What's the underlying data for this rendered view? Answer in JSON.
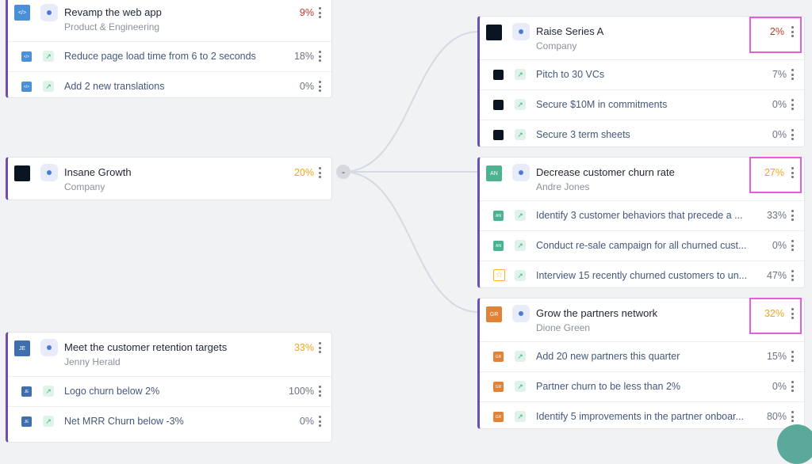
{
  "cards": {
    "web": {
      "title": "Revamp the web app",
      "owner": "Product & Engineering",
      "progress": "9%",
      "icon": "code-window-icon",
      "rows": [
        {
          "label": "Reduce page load time from 6 to 2 seconds",
          "progress": "18%"
        },
        {
          "label": "Add 2 new translations",
          "progress": "0%"
        }
      ]
    },
    "growth": {
      "title": "Insane Growth",
      "owner": "Company",
      "progress": "20%",
      "collapse_label": "-"
    },
    "retention": {
      "title": "Meet the customer retention targets",
      "owner": "Jenny Herald",
      "progress": "33%",
      "initials": "JE",
      "rows": [
        {
          "label": "Logo churn below 2%",
          "progress": "100%",
          "initials": "JE"
        },
        {
          "label": "Net MRR Churn below -3%",
          "progress": "0%",
          "initials": "JE"
        }
      ]
    },
    "series_a": {
      "title": "Raise Series A",
      "owner": "Company",
      "progress": "2%",
      "rows": [
        {
          "label": "Pitch to 30 VCs",
          "progress": "7%"
        },
        {
          "label": "Secure $10M in commitments",
          "progress": "0%"
        },
        {
          "label": "Secure 3 term sheets",
          "progress": "0%"
        }
      ]
    },
    "churn": {
      "title": "Decrease customer churn rate",
      "owner": "Andre Jones",
      "progress": "27%",
      "initials": "AN",
      "rows": [
        {
          "label": "Identify 3 customer behaviors that precede a ...",
          "progress": "33%",
          "initials": "AN"
        },
        {
          "label": "Conduct re-sale campaign for all churned cust...",
          "progress": "0%",
          "initials": "AN"
        },
        {
          "label": "Interview 15 recently churned customers to un...",
          "progress": "47%",
          "icon": "star-icon"
        }
      ]
    },
    "partners": {
      "title": "Grow the partners network",
      "owner": "Dione Green",
      "progress": "32%",
      "initials": "GR",
      "rows": [
        {
          "label": "Add 20 new partners this quarter",
          "progress": "15%",
          "initials": "GR"
        },
        {
          "label": "Partner churn to be less than 2%",
          "progress": "0%",
          "initials": "GR"
        },
        {
          "label": "Identify 5 improvements in the partner onboar...",
          "progress": "80%",
          "initials": "GR"
        }
      ]
    }
  },
  "colors": {
    "accent_border": "#6a4fb0",
    "highlight": "#e65ddb",
    "low_progress": "#c0392b",
    "mid_progress": "#f0a81a"
  }
}
